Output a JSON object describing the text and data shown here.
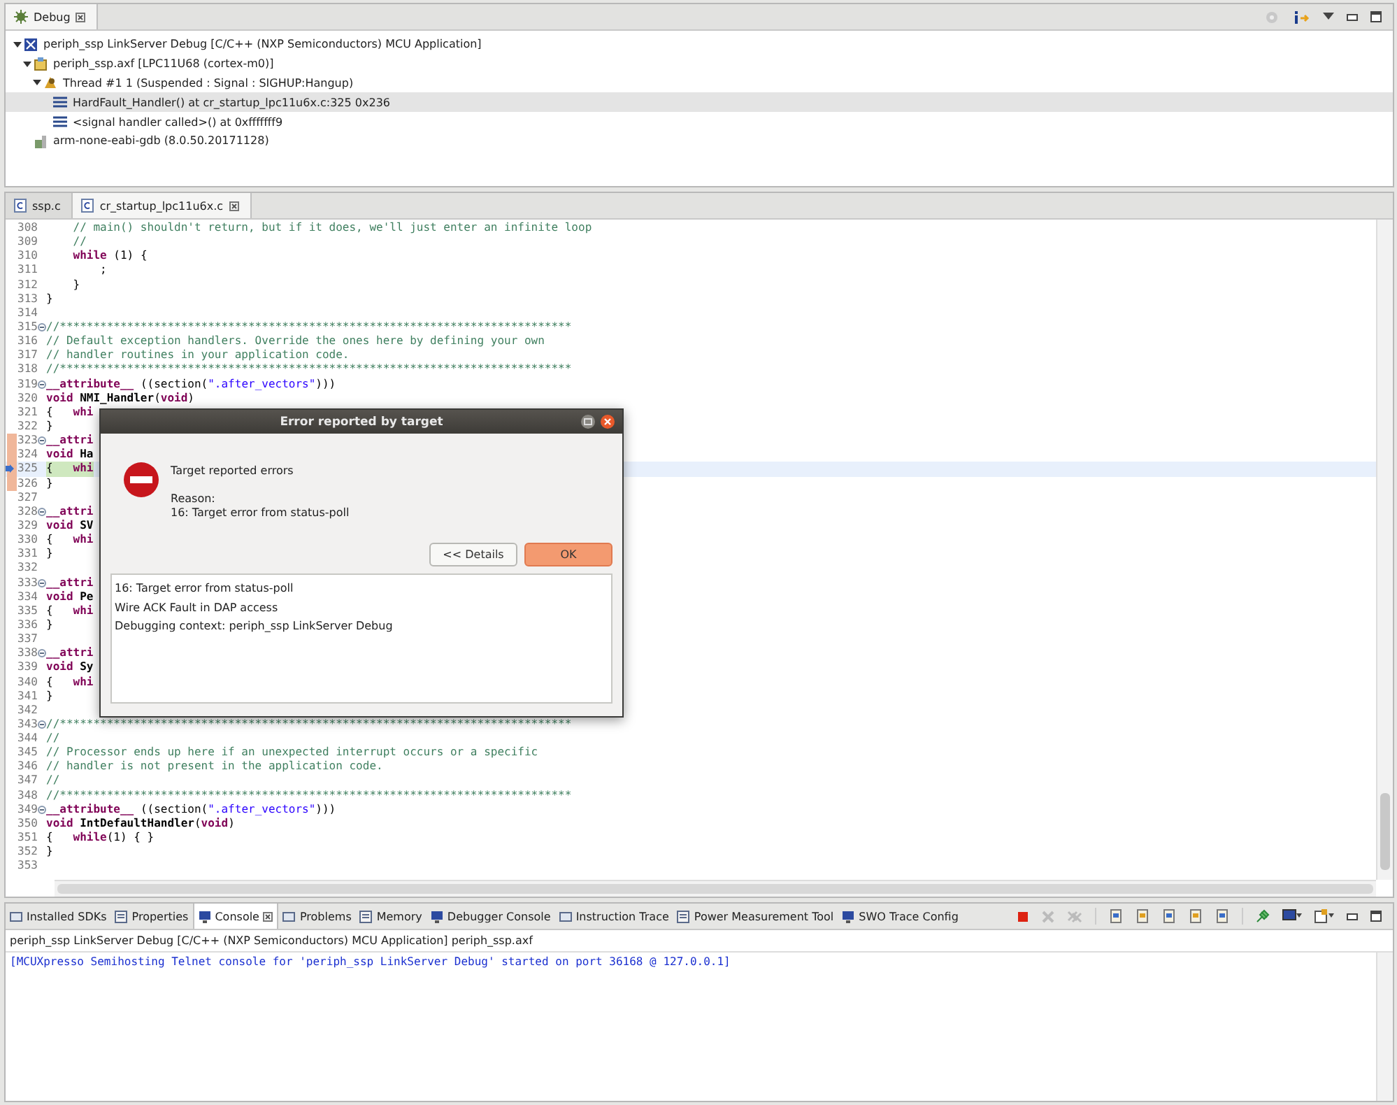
{
  "debug_view": {
    "tab": {
      "label": "Debug",
      "selected": true
    },
    "tree": [
      {
        "kind": "launch",
        "label": "periph_ssp LinkServer Debug [C/C++ (NXP Semiconductors) MCU Application]",
        "expanded": true,
        "selected": false,
        "children": [
          {
            "kind": "process",
            "label": "periph_ssp.axf [LPC11U68 (cortex-m0)]",
            "expanded": true,
            "selected": false,
            "children": [
              {
                "kind": "thread",
                "label": "Thread #1 1 (Suspended : Signal : SIGHUP:Hangup)",
                "expanded": true,
                "selected": false,
                "children": [
                  {
                    "kind": "frame",
                    "label": "HardFault_Handler() at cr_startup_lpc11u6x.c:325 0x236",
                    "selected": true
                  },
                  {
                    "kind": "frame",
                    "label": "<signal handler called>() at 0xfffffff9",
                    "selected": false
                  }
                ]
              }
            ]
          },
          {
            "kind": "gdb",
            "label": "arm-none-eabi-gdb (8.0.50.20171128)",
            "selected": false
          }
        ]
      }
    ]
  },
  "editor": {
    "tabs": [
      {
        "label": "ssp.c",
        "selected": false
      },
      {
        "label": "cr_startup_lpc11u6x.c",
        "selected": true
      }
    ],
    "lines": [
      {
        "number": "308",
        "tokens": [
          {
            "kind": "comment",
            "text": "    // main() shouldn't return, but if it does, we'll just enter an infinite loop"
          }
        ]
      },
      {
        "number": "309",
        "tokens": [
          {
            "kind": "comment",
            "text": "    //"
          }
        ]
      },
      {
        "number": "310",
        "tokens": [
          {
            "kind": "keyword",
            "text": "    while"
          },
          {
            "kind": "plain",
            "text": " (1) {"
          }
        ]
      },
      {
        "number": "311",
        "tokens": [
          {
            "kind": "plain",
            "text": "        ;"
          }
        ]
      },
      {
        "number": "312",
        "tokens": [
          {
            "kind": "plain",
            "text": "    }"
          }
        ]
      },
      {
        "number": "313",
        "tokens": [
          {
            "kind": "plain",
            "text": "}"
          }
        ]
      },
      {
        "number": "314"
      },
      {
        "number": "315",
        "fold": true,
        "tokens": [
          {
            "kind": "comment",
            "text": "//****************************************************************************"
          }
        ]
      },
      {
        "number": "316",
        "tokens": [
          {
            "kind": "comment",
            "text": "// Default exception handlers. Override the ones here by defining your own"
          }
        ]
      },
      {
        "number": "317",
        "tokens": [
          {
            "kind": "comment",
            "text": "// handler routines in your application code."
          }
        ]
      },
      {
        "number": "318",
        "tokens": [
          {
            "kind": "comment",
            "text": "//****************************************************************************"
          }
        ]
      },
      {
        "number": "319",
        "fold": true,
        "tokens": [
          {
            "kind": "keyword",
            "text": "__attribute__"
          },
          {
            "kind": "plain",
            "text": " ((section("
          },
          {
            "kind": "string",
            "text": "\".after_vectors\""
          },
          {
            "kind": "plain",
            "text": ")))"
          }
        ]
      },
      {
        "number": "320",
        "tokens": [
          {
            "kind": "keyword",
            "text": "void"
          },
          {
            "kind": "name",
            "text": " NMI_Handler"
          },
          {
            "kind": "plain",
            "text": "("
          },
          {
            "kind": "keyword",
            "text": "void"
          },
          {
            "kind": "plain",
            "text": ")"
          }
        ]
      },
      {
        "number": "321",
        "tokens": [
          {
            "kind": "plain",
            "text": "{   "
          },
          {
            "kind": "keyword",
            "text": "whi"
          }
        ]
      },
      {
        "number": "322",
        "tokens": [
          {
            "kind": "plain",
            "text": "}"
          }
        ]
      },
      {
        "number": "323",
        "fold": true,
        "marked": true,
        "tokens": [
          {
            "kind": "keyword",
            "text": "__attri"
          }
        ]
      },
      {
        "number": "324",
        "marked": true,
        "tokens": [
          {
            "kind": "keyword",
            "text": "void"
          },
          {
            "kind": "name",
            "text": " Ha"
          }
        ]
      },
      {
        "number": "325",
        "marked": true,
        "current": true,
        "tokens": [
          {
            "kind": "plain",
            "text": "{   "
          },
          {
            "kind": "keyword",
            "text": "whi"
          }
        ]
      },
      {
        "number": "326",
        "marked": true,
        "tokens": [
          {
            "kind": "plain",
            "text": "}"
          }
        ]
      },
      {
        "number": "327"
      },
      {
        "number": "328",
        "fold": true,
        "tokens": [
          {
            "kind": "keyword",
            "text": "__attri"
          }
        ]
      },
      {
        "number": "329",
        "tokens": [
          {
            "kind": "keyword",
            "text": "void"
          },
          {
            "kind": "name",
            "text": " SV"
          }
        ]
      },
      {
        "number": "330",
        "tokens": [
          {
            "kind": "plain",
            "text": "{   "
          },
          {
            "kind": "keyword",
            "text": "whi"
          }
        ]
      },
      {
        "number": "331",
        "tokens": [
          {
            "kind": "plain",
            "text": "}"
          }
        ]
      },
      {
        "number": "332"
      },
      {
        "number": "333",
        "fold": true,
        "tokens": [
          {
            "kind": "keyword",
            "text": "__attri"
          }
        ]
      },
      {
        "number": "334",
        "tokens": [
          {
            "kind": "keyword",
            "text": "void"
          },
          {
            "kind": "name",
            "text": " Pe"
          }
        ]
      },
      {
        "number": "335",
        "tokens": [
          {
            "kind": "plain",
            "text": "{   "
          },
          {
            "kind": "keyword",
            "text": "whi"
          }
        ]
      },
      {
        "number": "336",
        "tokens": [
          {
            "kind": "plain",
            "text": "}"
          }
        ]
      },
      {
        "number": "337"
      },
      {
        "number": "338",
        "fold": true,
        "tokens": [
          {
            "kind": "keyword",
            "text": "__attri"
          }
        ]
      },
      {
        "number": "339",
        "tokens": [
          {
            "kind": "keyword",
            "text": "void"
          },
          {
            "kind": "name",
            "text": " Sy"
          }
        ]
      },
      {
        "number": "340",
        "tokens": [
          {
            "kind": "plain",
            "text": "{   "
          },
          {
            "kind": "keyword",
            "text": "whi"
          }
        ]
      },
      {
        "number": "341",
        "tokens": [
          {
            "kind": "plain",
            "text": "}"
          }
        ]
      },
      {
        "number": "342"
      },
      {
        "number": "343",
        "fold": true,
        "tokens": [
          {
            "kind": "comment",
            "text": "//****************************************************************************"
          }
        ]
      },
      {
        "number": "344",
        "tokens": [
          {
            "kind": "comment",
            "text": "//"
          }
        ]
      },
      {
        "number": "345",
        "tokens": [
          {
            "kind": "comment",
            "text": "// Processor ends up here if an unexpected interrupt occurs or a specific"
          }
        ]
      },
      {
        "number": "346",
        "tokens": [
          {
            "kind": "comment",
            "text": "// handler is not present in the application code."
          }
        ]
      },
      {
        "number": "347",
        "tokens": [
          {
            "kind": "comment",
            "text": "//"
          }
        ]
      },
      {
        "number": "348",
        "tokens": [
          {
            "kind": "comment",
            "text": "//****************************************************************************"
          }
        ]
      },
      {
        "number": "349",
        "fold": true,
        "tokens": [
          {
            "kind": "keyword",
            "text": "__attribute__"
          },
          {
            "kind": "plain",
            "text": " ((section("
          },
          {
            "kind": "string",
            "text": "\".after_vectors\""
          },
          {
            "kind": "plain",
            "text": ")))"
          }
        ]
      },
      {
        "number": "350",
        "tokens": [
          {
            "kind": "keyword",
            "text": "void"
          },
          {
            "kind": "name",
            "text": " IntDefaultHandler"
          },
          {
            "kind": "plain",
            "text": "("
          },
          {
            "kind": "keyword",
            "text": "void"
          },
          {
            "kind": "plain",
            "text": ")"
          }
        ]
      },
      {
        "number": "351",
        "tokens": [
          {
            "kind": "plain",
            "text": "{   "
          },
          {
            "kind": "keyword",
            "text": "while"
          },
          {
            "kind": "plain",
            "text": "(1) { }"
          }
        ]
      },
      {
        "number": "352",
        "tokens": [
          {
            "kind": "plain",
            "text": "}"
          }
        ]
      },
      {
        "number": "353"
      }
    ]
  },
  "dialog": {
    "title": "Error reported by target",
    "message": "Target reported errors",
    "reason_label": "Reason:",
    "reason": "16: Target error from status-poll",
    "buttons": [
      {
        "label": "<< Details",
        "default": false
      },
      {
        "label": "OK",
        "default": true
      }
    ],
    "details": [
      "16: Target error from status-poll",
      "Wire ACK Fault in DAP access",
      "Debugging context: periph_ssp LinkServer Debug"
    ]
  },
  "console_view": {
    "tabs": [
      {
        "label": "Installed SDKs",
        "selected": false
      },
      {
        "label": "Properties",
        "selected": false
      },
      {
        "label": "Console",
        "selected": true
      },
      {
        "label": "Problems",
        "selected": false
      },
      {
        "label": "Memory",
        "selected": false
      },
      {
        "label": "Debugger Console",
        "selected": false
      },
      {
        "label": "Instruction Trace",
        "selected": false
      },
      {
        "label": "Power Measurement Tool",
        "selected": false
      },
      {
        "label": "SWO Trace Config",
        "selected": false
      }
    ],
    "header": "periph_ssp LinkServer Debug [C/C++ (NXP Semiconductors) MCU Application] periph_ssp.axf",
    "output": [
      "[MCUXpresso Semihosting Telnet console for 'periph_ssp LinkServer Debug' started on port 36168 @ 127.0.0.1]"
    ]
  }
}
